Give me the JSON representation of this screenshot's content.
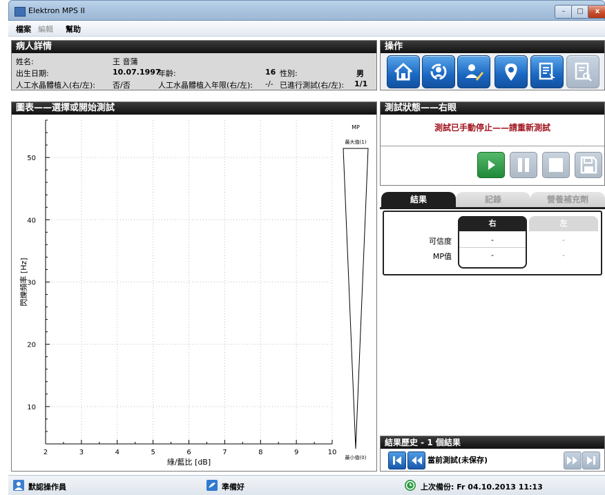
{
  "window": {
    "title": "Elektron MPS II",
    "minimize": "–",
    "maximize": "□",
    "close": "x"
  },
  "menu": {
    "file": "檔案",
    "edit": "編輯",
    "help": "幫助"
  },
  "patient": {
    "header": "病人詳情",
    "name_label": "姓名:",
    "name_value": "王 音蒲",
    "dob_label": "出生日期:",
    "dob_value": "10.07.1997",
    "age_label": "年齡:",
    "age_value": "16",
    "sex_label": "性別:",
    "sex_value": "男",
    "iol_label": "人工水晶體植入(右/左):",
    "iol_value": "否/否",
    "iol_years_label": "人工水晶體植入年限(右/左):",
    "iol_years_value": "-/-",
    "tests_done_label": "已進行測試(右/左):",
    "tests_done_value": "1/1"
  },
  "actions": {
    "header": "操作",
    "buttons": [
      {
        "icon": "home-icon"
      },
      {
        "icon": "patient-refresh-icon"
      },
      {
        "icon": "edit-patient-icon"
      },
      {
        "icon": "eye-icon"
      },
      {
        "icon": "report-select-icon"
      },
      {
        "icon": "report-search-icon"
      }
    ]
  },
  "chart_panel": {
    "header": "圖表——選擇或開始測試"
  },
  "chart_data": {
    "type": "scatter",
    "xlabel": "綠/藍比 [dB]",
    "ylabel": "閃爍頻率 [Hz]",
    "xlim": [
      2,
      10
    ],
    "ylim": [
      4,
      56
    ],
    "xticks": [
      2,
      3,
      4,
      5,
      6,
      7,
      8,
      9,
      10
    ],
    "yticks": [
      10,
      20,
      30,
      40,
      50
    ],
    "grid": true,
    "series": [],
    "mp_scale": {
      "title": "MP",
      "max_label": "最大值(1)",
      "min_label": "最小值(0)"
    }
  },
  "test_status": {
    "header": "測試狀態——右眼",
    "message": "測試已手動停止——請重新測試",
    "buttons": [
      {
        "icon": "play-icon"
      },
      {
        "icon": "pause-icon"
      },
      {
        "icon": "stop-icon"
      },
      {
        "icon": "save-icon"
      }
    ]
  },
  "tabs": {
    "results": "結果",
    "records": "記錄",
    "supplements": "營養補充劑"
  },
  "results": {
    "col_right": "右",
    "col_left": "左",
    "rows": [
      {
        "label": "可信度",
        "right": "-",
        "left": "-"
      },
      {
        "label": "MP值",
        "right": "-",
        "left": "-"
      }
    ]
  },
  "history": {
    "header": "結果歷史 - 1 個結果",
    "current": "當前測試(未保存)"
  },
  "statusbar": {
    "operator": "默認操作員",
    "ready": "準備好",
    "backup": "上次備份: Fr 04.10.2013 11:13"
  },
  "colors": {
    "accent_red": "#a0141e",
    "button_blue": "#1a67c2",
    "play_green": "#1f8a3a",
    "header_dark": "#1c1c1c"
  }
}
